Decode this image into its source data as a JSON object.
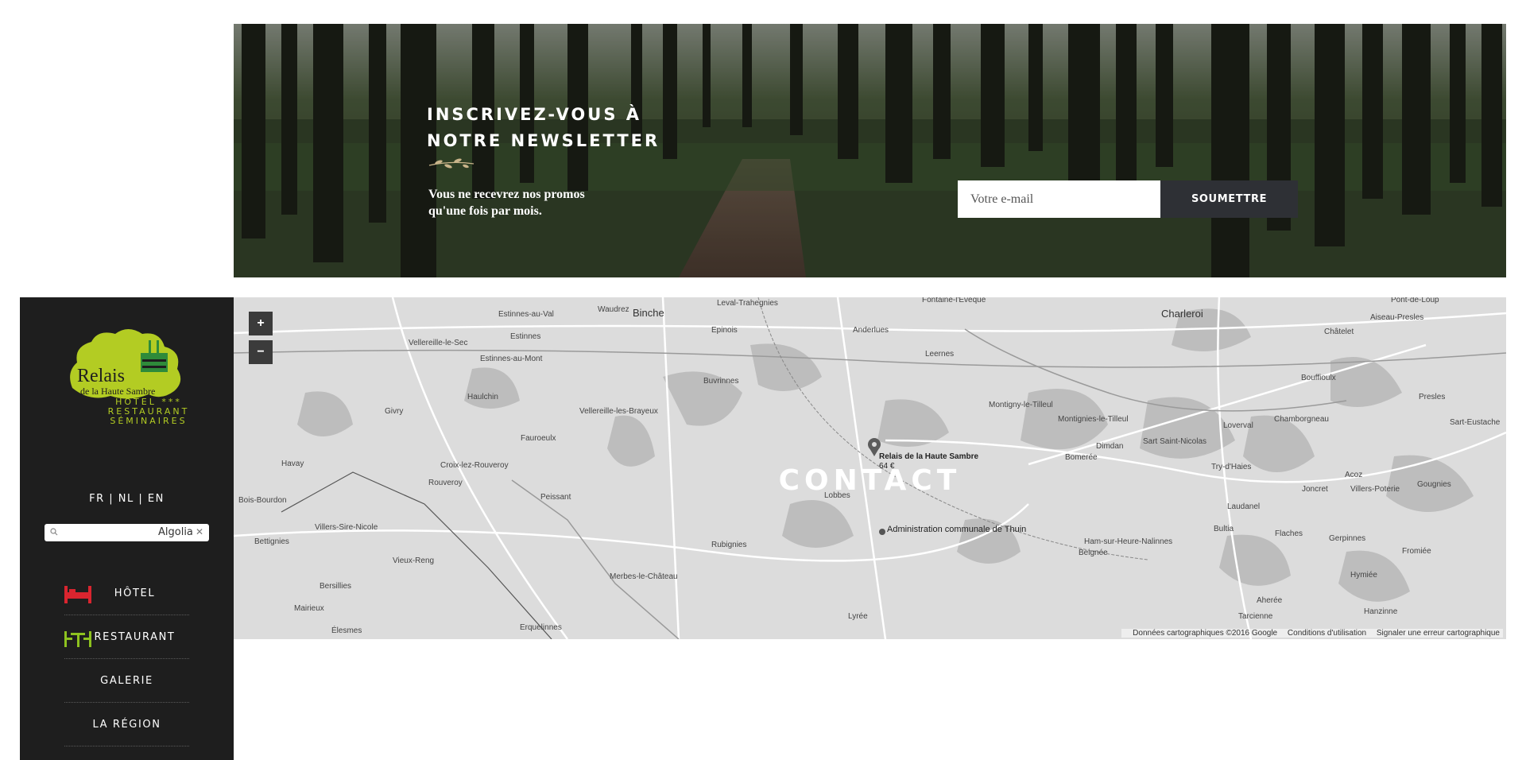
{
  "newsletter": {
    "title": "INSCRIVEZ-VOUS À\nNOTRE NEWSLETTER",
    "subtitle": "Vous ne recevrez nos promos qu'une fois par mois.",
    "email_placeholder": "Votre e-mail",
    "submit_label": "SOUMETTRE"
  },
  "sidebar": {
    "logo": {
      "name": "Relais",
      "name_sub": "de la Haute Sambre",
      "lines": [
        "HÔTEL ***",
        "RESTAURANT",
        "SÉMINAIRES"
      ]
    },
    "languages": [
      "FR",
      "NL",
      "EN"
    ],
    "search": {
      "placeholder": "",
      "provider": "Algolia"
    },
    "nav": [
      {
        "label": "HÔTEL",
        "icon": "bed-icon"
      },
      {
        "label": "RESTAURANT",
        "icon": "table-icon"
      },
      {
        "label": "GALERIE",
        "icon": ""
      },
      {
        "label": "LA RÉGION",
        "icon": ""
      }
    ]
  },
  "map": {
    "title": "CONTACT",
    "zoom_in": "+",
    "zoom_out": "−",
    "marker": {
      "name": "Relais de la Haute Sambre",
      "price": "64 €"
    },
    "attribution": {
      "data": "Données cartographiques ©2016 Google",
      "terms": "Conditions d'utilisation",
      "report": "Signaler une erreur cartographique"
    },
    "places": [
      "Leval-Trahegnies",
      "Fontaine-l'Evêque",
      "Pont-de-Loup",
      "Estinnes-au-Val",
      "Waudrez",
      "Binche",
      "Charleroi",
      "Châtelet",
      "Aiseau-Presles",
      "Epinois",
      "Anderlues",
      "Vellereille-le-Sec",
      "Estinnes",
      "Leernes",
      "Estinnes-au-Mont",
      "Buvrinnes",
      "Bouffioulx",
      "Haulchin",
      "Montigny-le-Tilleul",
      "Montignies-le-Tilleul",
      "Presles",
      "Vellereille-les-Brayeux",
      "Loverval",
      "Chamborgneau",
      "Sart-Eustache",
      "Givry",
      "Fauroeulx",
      "Dimdan",
      "Sart\nSaint-Nicolas",
      "Bomerée",
      "Havay",
      "Croix-lez-Rouveroy",
      "Try-d'Haies",
      "Rouveroy",
      "Acoz",
      "Gougnies",
      "Bois-Bourdon",
      "Peissant",
      "Lobbes",
      "Joncret",
      "Villers-Poterie",
      "Laudanel",
      "Villers-Sire-Nicole",
      "Administration\ncommunale de Thuin",
      "Bultia",
      "Flaches",
      "Gerpinnes",
      "Bettignies",
      "Rubignies",
      "Ham-sur-Heure-Nalinnes",
      "Fromiée",
      "Vieux-Reng",
      "Beignée",
      "Bersillies",
      "Merbes-le-Château",
      "Hymiée",
      "Mairieux",
      "Aherée",
      "Hanzinne",
      "Tarcienne",
      "Lyrée",
      "Élesmes",
      "Erquelinnes"
    ]
  },
  "colors": {
    "accent_green": "#b3cc23",
    "sidebar_bg": "#1e1e1e",
    "submit_bg": "#2e3035",
    "hotel_icon": "#d9252f",
    "restaurant_icon": "#8dc21f"
  }
}
